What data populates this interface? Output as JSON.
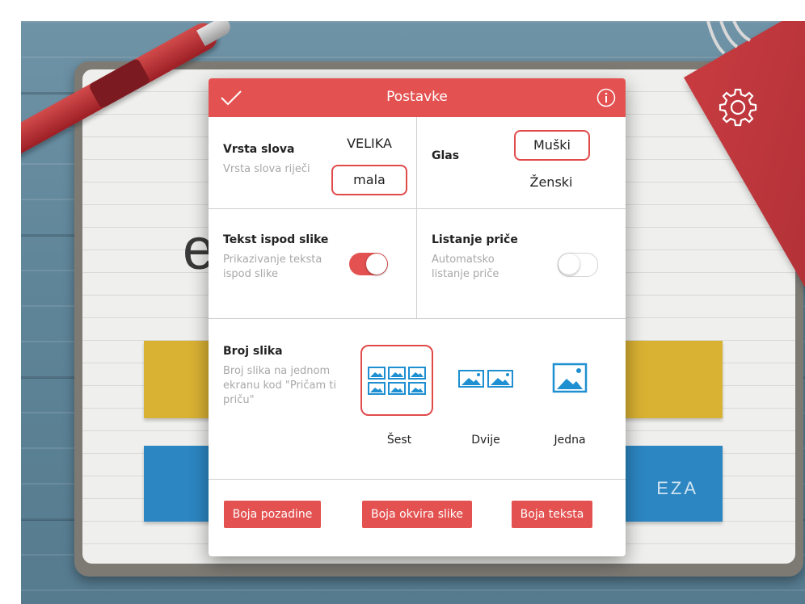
{
  "background": {
    "big_letter": "e",
    "blue_band_label": "EZA"
  },
  "modal": {
    "title": "Postavke",
    "header_icons": [
      "check-icon",
      "info-icon"
    ],
    "accent_color": "#e35251",
    "font_case": {
      "title": "Vrsta slova",
      "description": "Vrsta slova riječi",
      "options": [
        "VELIKA",
        "mala"
      ],
      "selected": "mala"
    },
    "voice": {
      "title": "Glas",
      "options": [
        "Muški",
        "Ženski"
      ],
      "selected": "Muški"
    },
    "caption": {
      "title": "Tekst ispod slike",
      "description": "Prikazivanje teksta ispod slike",
      "enabled": true
    },
    "paging": {
      "title": "Listanje priče",
      "description": "Automatsko listanje priče",
      "enabled": false
    },
    "image_count": {
      "title": "Broj slika",
      "description": "Broj slika na jednom ekranu kod \"Pričam ti priču\"",
      "options": [
        "Šest",
        "Dvije",
        "Jedna"
      ],
      "selected": "Šest"
    },
    "buttons": {
      "background_color": "Boja pozadine",
      "frame_color": "Boja okvira slike",
      "text_color": "Boja teksta"
    }
  }
}
